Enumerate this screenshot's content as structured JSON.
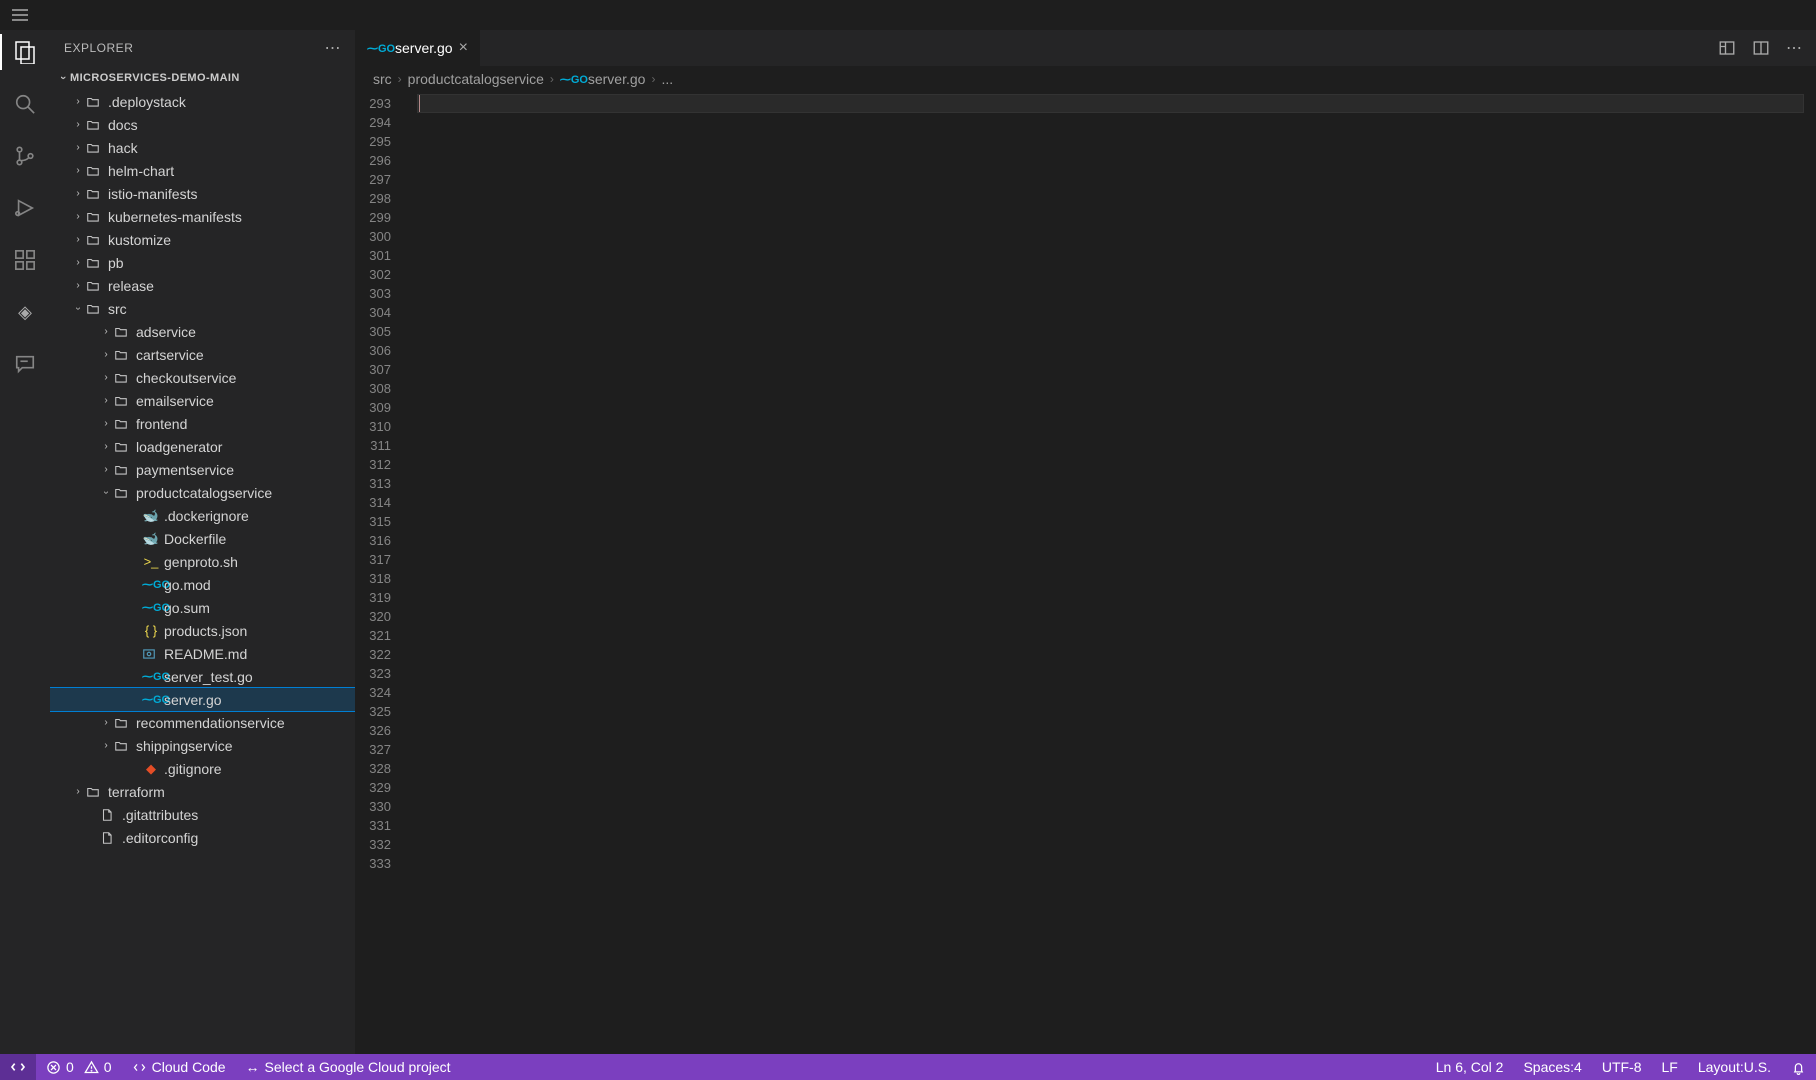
{
  "sidebar": {
    "title": "EXPLORER",
    "root": "MICROSERVICES-DEMO-MAIN",
    "top_folders": [
      {
        "label": ".deploystack"
      },
      {
        "label": "docs"
      },
      {
        "label": "hack"
      },
      {
        "label": "helm-chart"
      },
      {
        "label": "istio-manifests"
      },
      {
        "label": "kubernetes-manifests"
      },
      {
        "label": "kustomize"
      },
      {
        "label": "pb"
      },
      {
        "label": "release"
      }
    ],
    "src": {
      "label": "src",
      "services": [
        {
          "label": "adservice"
        },
        {
          "label": "cartservice"
        },
        {
          "label": "checkoutservice"
        },
        {
          "label": "emailservice"
        },
        {
          "label": "frontend"
        },
        {
          "label": "loadgenerator"
        },
        {
          "label": "paymentservice"
        }
      ],
      "productcatalog": {
        "label": "productcatalogservice",
        "files": [
          {
            "label": ".dockerignore",
            "icon": "docker"
          },
          {
            "label": "Dockerfile",
            "icon": "docker"
          },
          {
            "label": "genproto.sh",
            "icon": "shell"
          },
          {
            "label": "go.mod",
            "icon": "go"
          },
          {
            "label": "go.sum",
            "icon": "go"
          },
          {
            "label": "products.json",
            "icon": "json"
          },
          {
            "label": "README.md",
            "icon": "md"
          },
          {
            "label": "server_test.go",
            "icon": "go"
          },
          {
            "label": "server.go",
            "icon": "go",
            "selected": true
          }
        ]
      },
      "below_services": [
        {
          "label": "recommendationservice"
        },
        {
          "label": "shippingservice"
        }
      ],
      "below_files": [
        {
          "label": ".gitignore",
          "icon": "git"
        }
      ]
    },
    "bottom_folders": [
      {
        "label": "terraform"
      }
    ],
    "bottom_files": [
      {
        "label": ".gitattributes"
      },
      {
        "label": ".editorconfig"
      }
    ]
  },
  "tab": {
    "file": "server.go"
  },
  "breadcrumbs": {
    "a": "src",
    "b": "productcatalogservice",
    "c": "server.go",
    "d": "..."
  },
  "editor": {
    "first_line": 293,
    "last_line": 333
  },
  "status": {
    "errors": "0",
    "warnings": "0",
    "cloudcode": "Cloud Code",
    "gcpproject": "Select a Google Cloud project",
    "cursor": "Ln 6, Col 2",
    "spaces": "Spaces:4",
    "encoding": "UTF-8",
    "eol": "LF",
    "layout": "Layout:U.S."
  }
}
